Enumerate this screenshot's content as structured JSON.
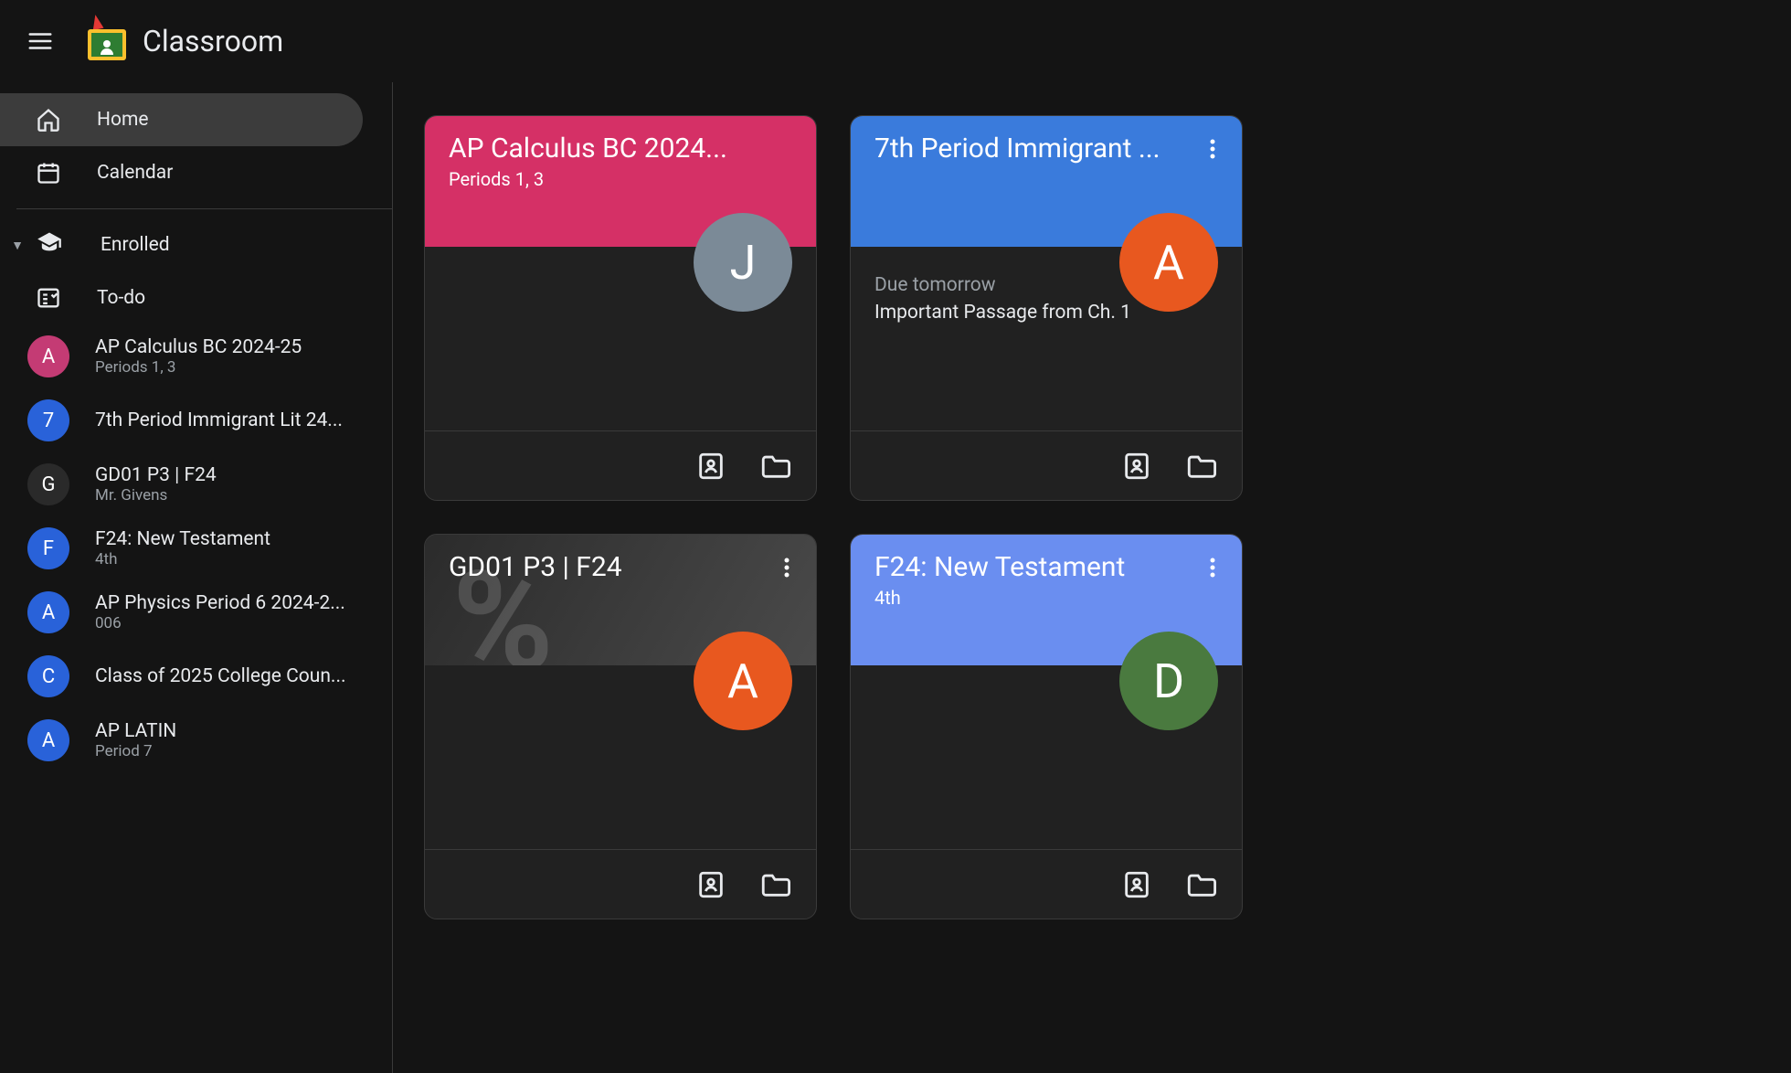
{
  "app": {
    "title": "Classroom"
  },
  "nav": {
    "home": "Home",
    "calendar": "Calendar",
    "enrolled": "Enrolled",
    "todo": "To-do"
  },
  "sidebarClasses": [
    {
      "initial": "A",
      "avatarClass": "av-pink",
      "title": "AP Calculus BC 2024-25",
      "sub": "Periods 1, 3"
    },
    {
      "initial": "7",
      "avatarClass": "av-blue",
      "title": "7th Period Immigrant Lit 24...",
      "sub": ""
    },
    {
      "initial": "G",
      "avatarClass": "av-letter",
      "title": "GD01 P3 | F24",
      "sub": "Mr. Givens"
    },
    {
      "initial": "F",
      "avatarClass": "av-blue",
      "title": "F24: New Testament",
      "sub": "4th"
    },
    {
      "initial": "A",
      "avatarClass": "av-blue",
      "title": "AP Physics Period 6 2024-2...",
      "sub": "006"
    },
    {
      "initial": "C",
      "avatarClass": "av-blue",
      "title": "Class of 2025 College Coun...",
      "sub": ""
    },
    {
      "initial": "A",
      "avatarClass": "av-blue",
      "title": "AP LATIN",
      "sub": "Period 7"
    }
  ],
  "cards": [
    {
      "title": "AP Calculus BC 2024...",
      "sub": "Periods 1, 3",
      "headerClass": "bg-pink",
      "teacherInitial": "J",
      "teacherAvatarClass": "av-steel",
      "showMenu": false,
      "dueLabel": "",
      "dueItem": ""
    },
    {
      "title": "7th Period Immigrant ...",
      "sub": "",
      "headerClass": "bg-blue",
      "teacherInitial": "A",
      "teacherAvatarClass": "av-orange",
      "showMenu": true,
      "dueLabel": "Due tomorrow",
      "dueItem": "Important Passage from Ch. 1"
    },
    {
      "title": "GD01 P3 | F24",
      "sub": "",
      "headerClass": "bg-gray",
      "teacherInitial": "A",
      "teacherAvatarClass": "av-orange",
      "showMenu": true,
      "dueLabel": "",
      "dueItem": ""
    },
    {
      "title": "F24: New Testament",
      "sub": "4th",
      "headerClass": "bg-lblue",
      "teacherInitial": "D",
      "teacherAvatarClass": "av-green",
      "showMenu": true,
      "dueLabel": "",
      "dueItem": ""
    }
  ]
}
